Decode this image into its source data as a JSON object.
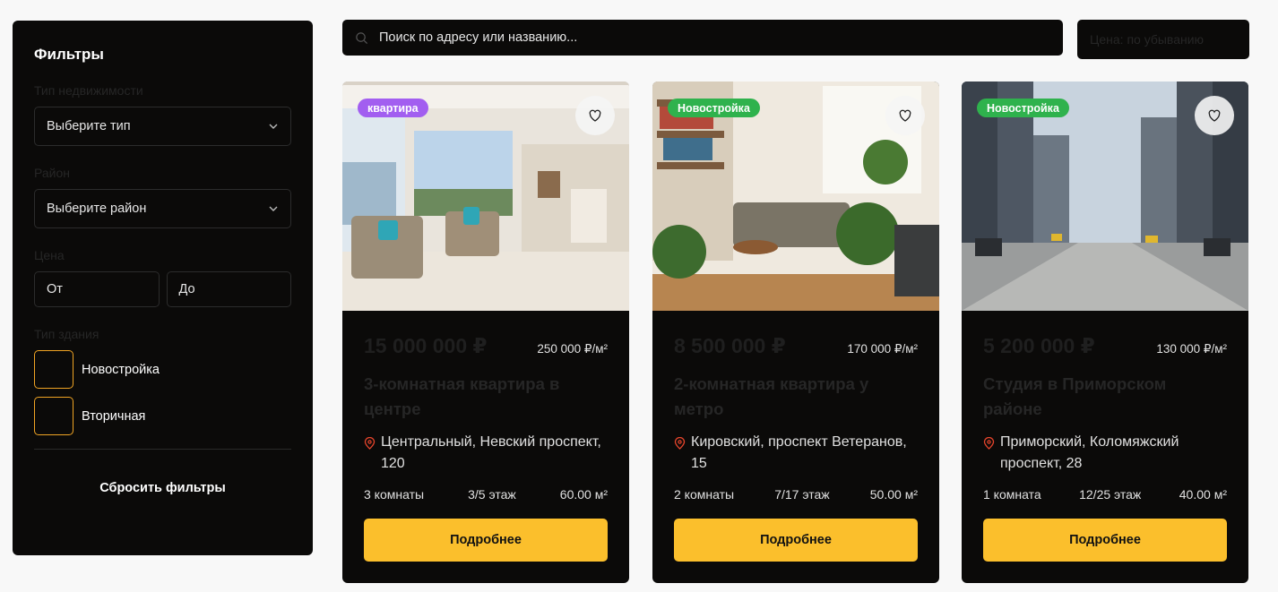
{
  "filters": {
    "title": "Фильтры",
    "property_type_label": "Тип недвижимости",
    "property_type_value": "Выберите тип",
    "district_label": "Район",
    "district_value": "Выберите район",
    "price_label": "Цена",
    "price_from_placeholder": "От",
    "price_to_placeholder": "До",
    "building_type_label": "Тип здания",
    "building_types": [
      {
        "label": "Новостройка",
        "checked": false
      },
      {
        "label": "Вторичная",
        "checked": false
      }
    ],
    "reset_label": "Сбросить фильтры"
  },
  "search": {
    "placeholder": "Поиск по адресу или названию..."
  },
  "sort": {
    "value": "Цена: по убыванию"
  },
  "colors": {
    "accent": "#fbbf2c",
    "checkbox_border": "#f0a424",
    "badge_apartment": "#a25ef0",
    "badge_new": "#2fb24d",
    "panel": "#0b0a09"
  },
  "listings": [
    {
      "badge": "квартира",
      "badge_color": "#a25ef0",
      "image": "living-room-photo",
      "price": "15 000 000 ₽",
      "price_per_m2": "250 000 ₽/м²",
      "title": "3-комнатная квартира в центре",
      "address": "Центральный, Невский проспект, 120",
      "rooms": "3 комнаты",
      "floor": "3/5 этаж",
      "area": "60.00 м²",
      "button": "Подробнее"
    },
    {
      "badge": "Новостройка",
      "badge_color": "#2fb24d",
      "image": "plants-living-room-photo",
      "price": "8 500 000 ₽",
      "price_per_m2": "170 000 ₽/м²",
      "title": "2-комнатная квартира у метро",
      "address": "Кировский, проспект Ветеранов, 15",
      "rooms": "2 комнаты",
      "floor": "7/17 этаж",
      "area": "50.00 м²",
      "button": "Подробнее"
    },
    {
      "badge": "Новостройка",
      "badge_color": "#2fb24d",
      "image": "city-street-photo",
      "price": "5 200 000 ₽",
      "price_per_m2": "130 000 ₽/м²",
      "title": "Студия в Приморском районе",
      "address": "Приморский, Коломяжский проспект, 28",
      "rooms": "1 комната",
      "floor": "12/25 этаж",
      "area": "40.00 м²",
      "button": "Подробнее"
    }
  ]
}
